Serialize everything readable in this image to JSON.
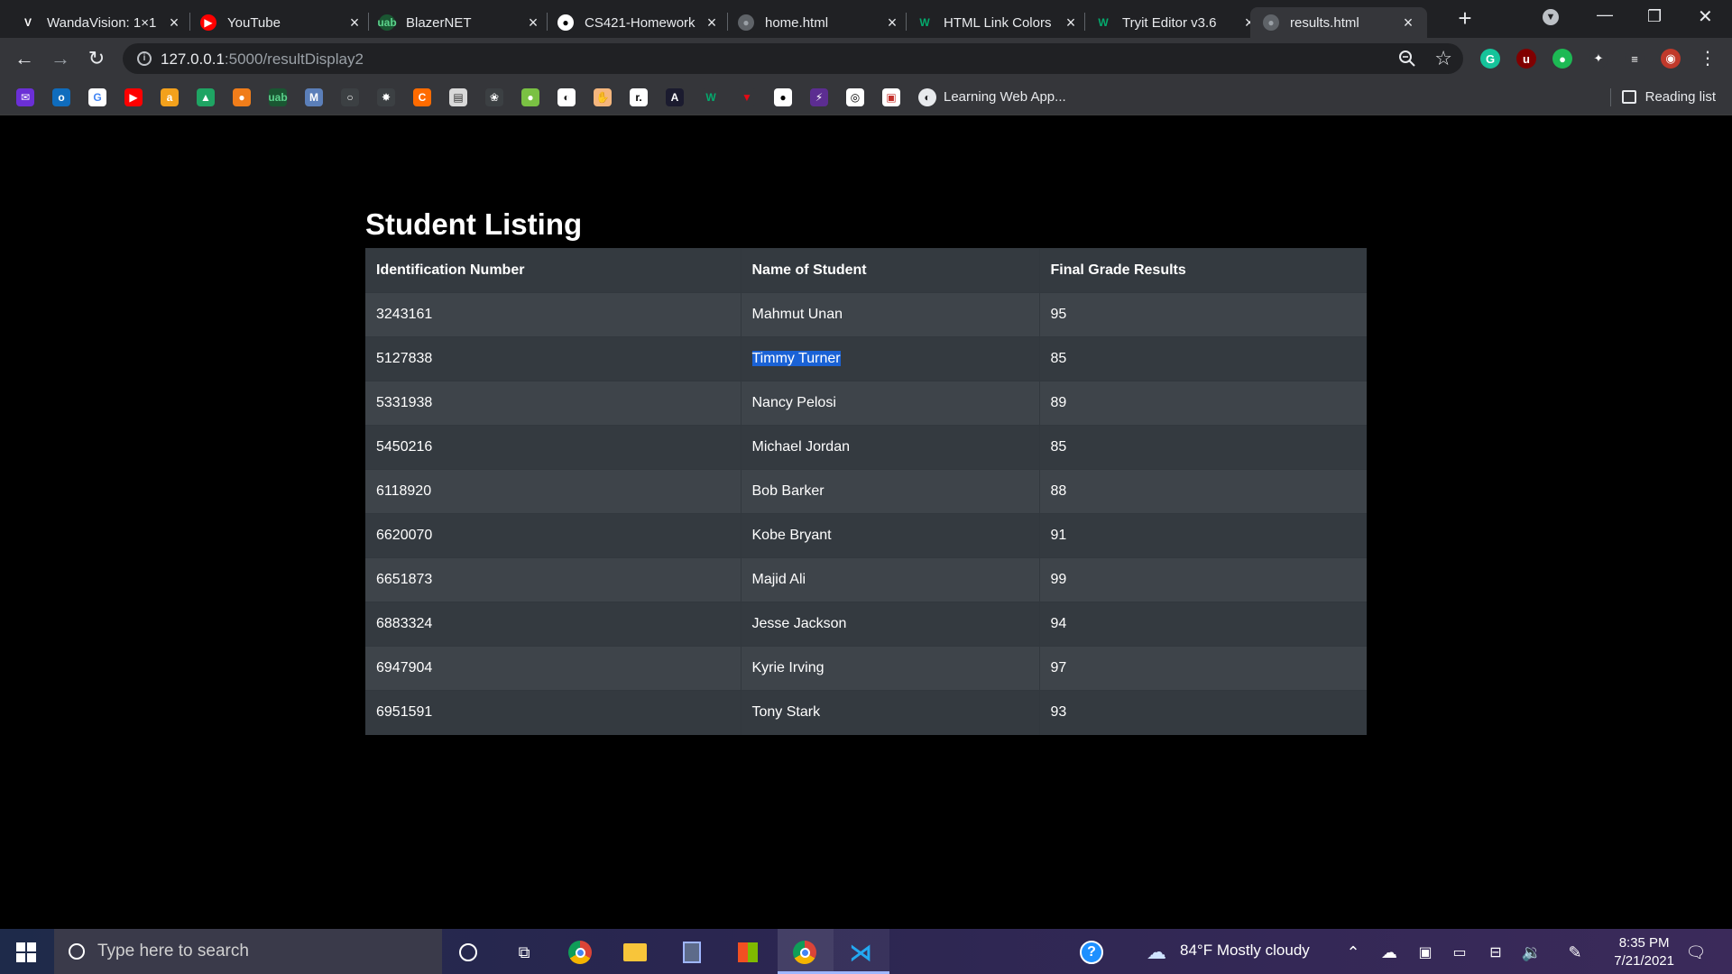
{
  "browser": {
    "tabs": [
      {
        "title": "WandaVision: 1×1",
        "favicon": "V",
        "favicon_color": "#202124",
        "favicon_text": "#fff"
      },
      {
        "title": "YouTube",
        "favicon": "▶",
        "favicon_color": "#ff0000",
        "favicon_text": "#fff"
      },
      {
        "title": "BlazerNET",
        "favicon": "uab",
        "favicon_color": "#1a5632",
        "favicon_text": "#5bd18b"
      },
      {
        "title": "CS421-Homework",
        "favicon": "●",
        "favicon_color": "#ffffff",
        "favicon_text": "#000"
      },
      {
        "title": "home.html",
        "favicon": "●",
        "favicon_color": "#5f6368",
        "favicon_text": "#9aa0a6"
      },
      {
        "title": "HTML Link Colors",
        "favicon": "W",
        "favicon_color": "#202124",
        "favicon_text": "#04aa6d"
      },
      {
        "title": "Tryit Editor v3.6",
        "favicon": "W",
        "favicon_color": "#202124",
        "favicon_text": "#04aa6d"
      },
      {
        "title": "results.html",
        "favicon": "●",
        "favicon_color": "#5f6368",
        "favicon_text": "#9aa0a6"
      }
    ],
    "active_tab_index": 7,
    "url_host": "127.0.0.1",
    "url_path": ":5000/resultDisplay2",
    "bookmark_folder_label": "Learning Web App...",
    "reading_list_label": "Reading list",
    "bookmark_icons": [
      {
        "glyph": "✉",
        "bg": "#6b2fd6"
      },
      {
        "glyph": "o",
        "bg": "#0f6cbd"
      },
      {
        "glyph": "G",
        "bg": "#ffffff",
        "fg": "#4285f4"
      },
      {
        "glyph": "▶",
        "bg": "#ff0000"
      },
      {
        "glyph": "a",
        "bg": "#f3a11c"
      },
      {
        "glyph": "▲",
        "bg": "#1fa463"
      },
      {
        "glyph": "●",
        "bg": "#f07d1a"
      },
      {
        "glyph": "uab",
        "bg": "#1a5632",
        "fg": "#5bd18b"
      },
      {
        "glyph": "M",
        "bg": "#5b7fb9"
      },
      {
        "glyph": "○",
        "bg": "#3c4043"
      },
      {
        "glyph": "✸",
        "bg": "#3c4043"
      },
      {
        "glyph": "C",
        "bg": "#ff6b00"
      },
      {
        "glyph": "▤",
        "bg": "#d9d9d9",
        "fg": "#333"
      },
      {
        "glyph": "❀",
        "bg": "#3c4043"
      },
      {
        "glyph": "●",
        "bg": "#7ac143"
      },
      {
        "glyph": "◐",
        "bg": "#ffffff",
        "fg": "#222"
      },
      {
        "glyph": "✋",
        "bg": "#f5b67d",
        "fg": "#7a4b1f"
      },
      {
        "glyph": "r.",
        "bg": "#ffffff",
        "fg": "#000"
      },
      {
        "glyph": "A",
        "bg": "#1b1b2f"
      },
      {
        "glyph": "W",
        "bg": "#35363a",
        "fg": "#04aa6d"
      },
      {
        "glyph": "▼",
        "bg": "#35363a",
        "fg": "#e50914"
      },
      {
        "glyph": "●",
        "bg": "#ffffff",
        "fg": "#000"
      },
      {
        "glyph": "⚡",
        "bg": "#5c2d91"
      },
      {
        "glyph": "◎",
        "bg": "#ffffff",
        "fg": "#000"
      },
      {
        "glyph": "▣",
        "bg": "#ffffff",
        "fg": "#c4302b"
      }
    ],
    "extensions": [
      {
        "glyph": "G",
        "bg": "#15c39a"
      },
      {
        "glyph": "u",
        "bg": "#800000"
      },
      {
        "glyph": "●",
        "bg": "#1db954"
      },
      {
        "glyph": "✦",
        "bg": "#35363a"
      },
      {
        "glyph": "≡",
        "bg": "#35363a"
      },
      {
        "glyph": "◉",
        "bg": "#c0392b"
      }
    ]
  },
  "page": {
    "title": "Student Listing",
    "columns": [
      "Identification Number",
      "Name of Student",
      "Final Grade Results"
    ],
    "rows": [
      {
        "id": "3243161",
        "name": "Mahmut Unan",
        "grade": "95"
      },
      {
        "id": "5127838",
        "name": "Timmy Turner",
        "grade": "85"
      },
      {
        "id": "5331938",
        "name": "Nancy Pelosi",
        "grade": "89"
      },
      {
        "id": "5450216",
        "name": "Michael Jordan",
        "grade": "85"
      },
      {
        "id": "6118920",
        "name": "Bob Barker",
        "grade": "88"
      },
      {
        "id": "6620070",
        "name": "Kobe Bryant",
        "grade": "91"
      },
      {
        "id": "6651873",
        "name": "Majid Ali",
        "grade": "99"
      },
      {
        "id": "6883324",
        "name": "Jesse Jackson",
        "grade": "94"
      },
      {
        "id": "6947904",
        "name": "Kyrie Irving",
        "grade": "97"
      },
      {
        "id": "6951591",
        "name": "Tony Stark",
        "grade": "93"
      }
    ],
    "selected_text": "Timmy Turner",
    "selection_color": "#1a62d6"
  },
  "taskbar": {
    "search_placeholder": "Type here to search",
    "weather": "84°F  Mostly cloudy",
    "time": "8:35 PM",
    "date": "7/21/2021"
  }
}
